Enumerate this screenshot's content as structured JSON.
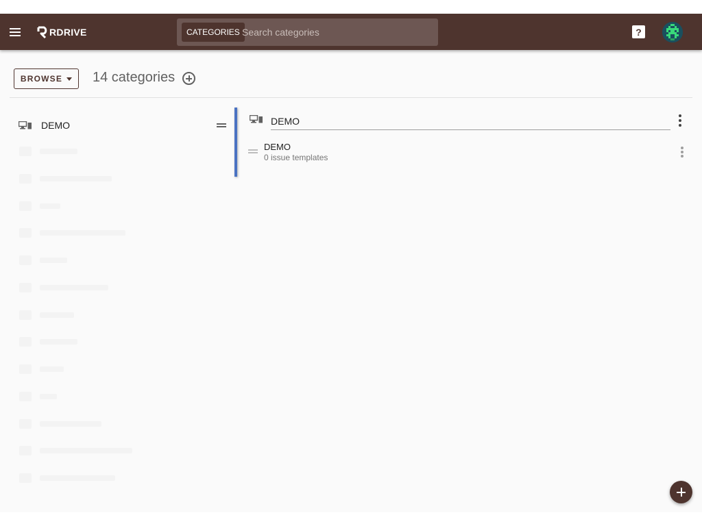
{
  "topbar": {
    "menu_icon": "hamburger-menu-icon",
    "logo_text": "RDRIVE",
    "search": {
      "chip_label": "CATEGORIES",
      "placeholder": "Search categories",
      "value": ""
    },
    "help_icon_glyph": "?",
    "help_icon": "help-icon",
    "avatar_icon": "pixel-avatar"
  },
  "toolbar": {
    "browse_label": "BROWSE",
    "count_label": "14 categories",
    "add_icon": "add-circle-icon"
  },
  "left_list": {
    "items": [
      {
        "label": "DEMO",
        "icon": "devices-icon"
      }
    ]
  },
  "detail": {
    "title_value": "DEMO",
    "icon": "devices-icon",
    "subitems": [
      {
        "title": "DEMO",
        "subtitle": "0 issue templates"
      }
    ]
  },
  "fab": {
    "icon": "add-icon"
  },
  "colors": {
    "primary": "#4e342e",
    "accent": "#4a72c2",
    "search_bg": "#6d5753",
    "background": "#fafafa"
  }
}
